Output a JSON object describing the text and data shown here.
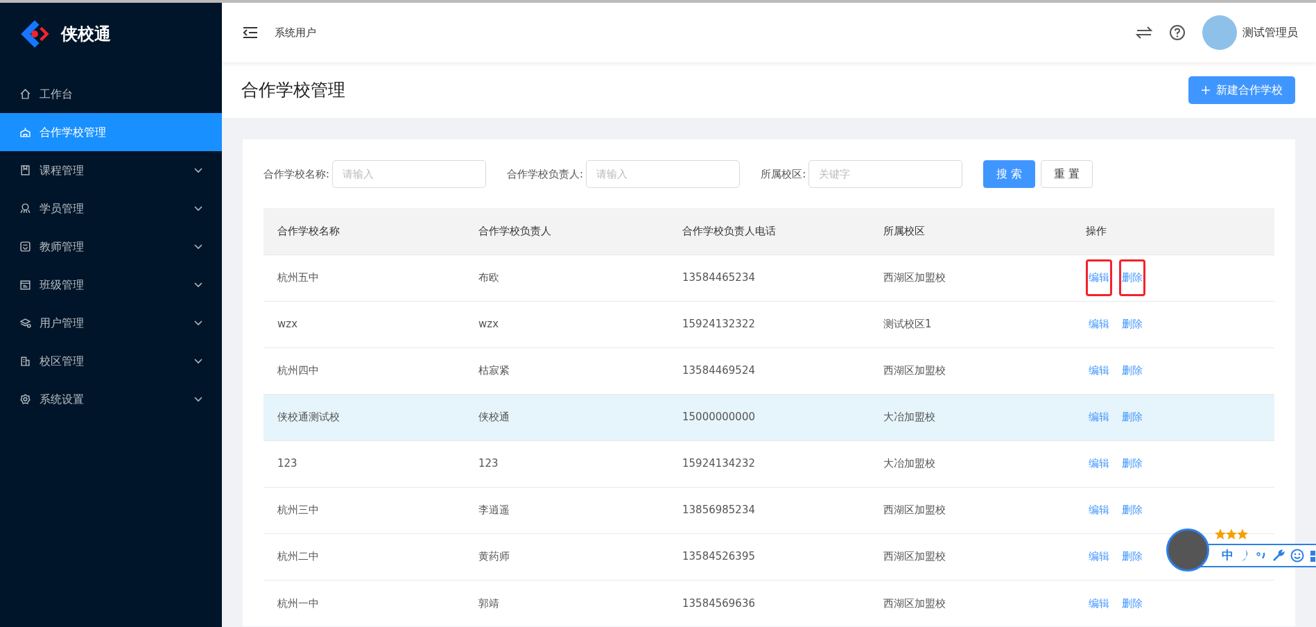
{
  "logo": {
    "text": "侠校通"
  },
  "sidebar": {
    "items": [
      {
        "label": "工作台",
        "selected": false,
        "expandable": false
      },
      {
        "label": "合作学校管理",
        "selected": true,
        "expandable": false
      },
      {
        "label": "课程管理",
        "selected": false,
        "expandable": true
      },
      {
        "label": "学员管理",
        "selected": false,
        "expandable": true
      },
      {
        "label": "教师管理",
        "selected": false,
        "expandable": true
      },
      {
        "label": "班级管理",
        "selected": false,
        "expandable": true
      },
      {
        "label": "用户管理",
        "selected": false,
        "expandable": true
      },
      {
        "label": "校区管理",
        "selected": false,
        "expandable": true
      },
      {
        "label": "系统设置",
        "selected": false,
        "expandable": true
      }
    ]
  },
  "header": {
    "breadcrumb": "系统用户",
    "user": "测试管理员"
  },
  "page": {
    "title": "合作学校管理",
    "new_button": "新建合作学校"
  },
  "filters": [
    {
      "label": "合作学校名称:",
      "placeholder": "请输入"
    },
    {
      "label": "合作学校负责人:",
      "placeholder": "请输入"
    },
    {
      "label": "所属校区:",
      "placeholder": "关键字"
    }
  ],
  "filter_buttons": [
    {
      "label": "搜 索",
      "kind": "primary"
    },
    {
      "label": "重 置",
      "kind": "default"
    }
  ],
  "table": {
    "columns": [
      "合作学校名称",
      "合作学校负责人",
      "合作学校负责人电话",
      "所属校区",
      "操作"
    ],
    "rows": [
      {
        "cells": [
          "杭州五中",
          "布欧",
          "13584465234",
          "西湖区加盟校"
        ],
        "actions": [
          {
            "label": "编辑",
            "highlighted": true
          },
          {
            "label": "删除",
            "highlighted": true
          }
        ],
        "selected": false
      },
      {
        "cells": [
          "wzx",
          "wzx",
          "15924132322",
          "测试校区1"
        ],
        "actions": [
          {
            "label": "编辑",
            "highlighted": false
          },
          {
            "label": "删除",
            "highlighted": false
          }
        ],
        "selected": false
      },
      {
        "cells": [
          "杭州四中",
          "枯寂紧",
          "13584469524",
          "西湖区加盟校"
        ],
        "actions": [
          {
            "label": "编辑",
            "highlighted": false
          },
          {
            "label": "删除",
            "highlighted": false
          }
        ],
        "selected": false
      },
      {
        "cells": [
          "侠校通测试校",
          "侠校通",
          "15000000000",
          "大冶加盟校"
        ],
        "actions": [
          {
            "label": "编辑",
            "highlighted": false
          },
          {
            "label": "删除",
            "highlighted": false
          }
        ],
        "selected": true
      },
      {
        "cells": [
          "123",
          "123",
          "15924134232",
          "大冶加盟校"
        ],
        "actions": [
          {
            "label": "编辑",
            "highlighted": false
          },
          {
            "label": "删除",
            "highlighted": false
          }
        ],
        "selected": false
      },
      {
        "cells": [
          "杭州三中",
          "李逍遥",
          "13856985234",
          "西湖区加盟校"
        ],
        "actions": [
          {
            "label": "编辑",
            "highlighted": false
          },
          {
            "label": "删除",
            "highlighted": false
          }
        ],
        "selected": false
      },
      {
        "cells": [
          "杭州二中",
          "黄药师",
          "13584526395",
          "西湖区加盟校"
        ],
        "actions": [
          {
            "label": "编辑",
            "highlighted": false
          },
          {
            "label": "删除",
            "highlighted": false
          }
        ],
        "selected": false
      },
      {
        "cells": [
          "杭州一中",
          "郭靖",
          "13584569636",
          "西湖区加盟校"
        ],
        "actions": [
          {
            "label": "编辑",
            "highlighted": false
          },
          {
            "label": "删除",
            "highlighted": false
          }
        ],
        "selected": false
      }
    ]
  },
  "ime_toolbar": {
    "stars": 3,
    "language": "中"
  }
}
